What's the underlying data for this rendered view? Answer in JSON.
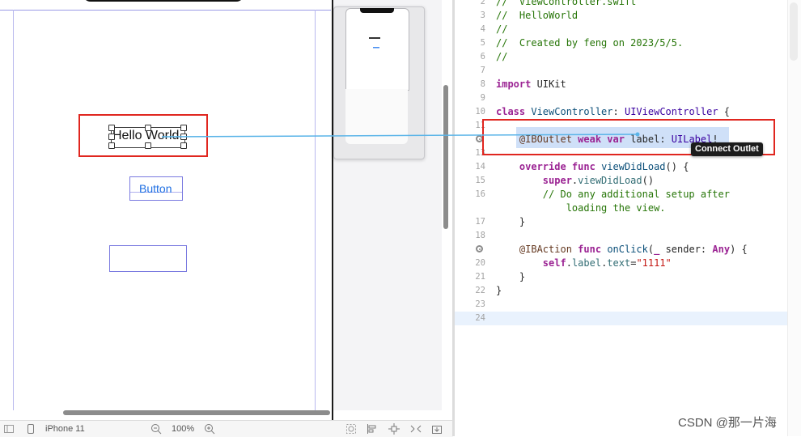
{
  "canvas": {
    "label_text": "Hello World",
    "button_label": "Button"
  },
  "bottom_toolbar": {
    "device_name": "iPhone 11",
    "zoom_level": "100%"
  },
  "editor": {
    "lines": [
      {
        "num": "2",
        "segments": [
          {
            "cls": "cm",
            "text": "//  ViewController.swift"
          }
        ]
      },
      {
        "num": "3",
        "segments": [
          {
            "cls": "cm",
            "text": "//  HelloWorld"
          }
        ]
      },
      {
        "num": "4",
        "segments": [
          {
            "cls": "cm",
            "text": "//"
          }
        ]
      },
      {
        "num": "5",
        "segments": [
          {
            "cls": "cm",
            "text": "//  Created by feng on 2023/5/5."
          }
        ]
      },
      {
        "num": "6",
        "segments": [
          {
            "cls": "cm",
            "text": "//"
          }
        ]
      },
      {
        "num": "7",
        "segments": []
      },
      {
        "num": "8",
        "segments": [
          {
            "cls": "k",
            "text": "import"
          },
          {
            "cls": "",
            "text": " UIKit"
          }
        ]
      },
      {
        "num": "9",
        "segments": []
      },
      {
        "num": "10",
        "segments": [
          {
            "cls": "k",
            "text": "class"
          },
          {
            "cls": "",
            "text": " "
          },
          {
            "cls": "t2",
            "text": "ViewController"
          },
          {
            "cls": "",
            "text": ": "
          },
          {
            "cls": "t",
            "text": "UIViewController"
          },
          {
            "cls": "",
            "text": " {"
          }
        ]
      },
      {
        "num": "11",
        "segments": []
      },
      {
        "num": "12",
        "segments": [
          {
            "cls": "",
            "text": "    "
          },
          {
            "cls": "at",
            "text": "@IBOutlet"
          },
          {
            "cls": "",
            "text": " "
          },
          {
            "cls": "k",
            "text": "weak var"
          },
          {
            "cls": "",
            "text": " label: "
          },
          {
            "cls": "t",
            "text": "UILabel"
          },
          {
            "cls": "",
            "text": "!"
          }
        ]
      },
      {
        "num": "13",
        "segments": []
      },
      {
        "num": "14",
        "segments": [
          {
            "cls": "",
            "text": "    "
          },
          {
            "cls": "k",
            "text": "override func"
          },
          {
            "cls": "",
            "text": " "
          },
          {
            "cls": "t2",
            "text": "viewDidLoad"
          },
          {
            "cls": "",
            "text": "() {"
          }
        ]
      },
      {
        "num": "15",
        "segments": [
          {
            "cls": "",
            "text": "        "
          },
          {
            "cls": "k",
            "text": "super"
          },
          {
            "cls": "",
            "text": "."
          },
          {
            "cls": "p",
            "text": "viewDidLoad"
          },
          {
            "cls": "",
            "text": "()"
          }
        ]
      },
      {
        "num": "16",
        "segments": [
          {
            "cls": "",
            "text": "        "
          },
          {
            "cls": "cm",
            "text": "// Do any additional setup after"
          }
        ]
      },
      {
        "num": "",
        "segments": [
          {
            "cls": "",
            "text": "            "
          },
          {
            "cls": "cm",
            "text": "loading the view."
          }
        ]
      },
      {
        "num": "17",
        "segments": [
          {
            "cls": "",
            "text": "    }"
          }
        ]
      },
      {
        "num": "18",
        "segments": []
      },
      {
        "num": "19",
        "segments": [
          {
            "cls": "",
            "text": "    "
          },
          {
            "cls": "at",
            "text": "@IBAction"
          },
          {
            "cls": "",
            "text": " "
          },
          {
            "cls": "k",
            "text": "func"
          },
          {
            "cls": "",
            "text": " "
          },
          {
            "cls": "t2",
            "text": "onClick"
          },
          {
            "cls": "",
            "text": "("
          },
          {
            "cls": "k",
            "text": "_"
          },
          {
            "cls": "",
            "text": " sender: "
          },
          {
            "cls": "k",
            "text": "Any"
          },
          {
            "cls": "",
            "text": ") {"
          }
        ]
      },
      {
        "num": "20",
        "segments": [
          {
            "cls": "",
            "text": "        "
          },
          {
            "cls": "k",
            "text": "self"
          },
          {
            "cls": "",
            "text": "."
          },
          {
            "cls": "p",
            "text": "label"
          },
          {
            "cls": "",
            "text": "."
          },
          {
            "cls": "p",
            "text": "text"
          },
          {
            "cls": "",
            "text": "="
          },
          {
            "cls": "s",
            "text": "\"1111\""
          }
        ]
      },
      {
        "num": "21",
        "segments": [
          {
            "cls": "",
            "text": "    }"
          }
        ]
      },
      {
        "num": "22",
        "segments": [
          {
            "cls": "",
            "text": "}"
          }
        ]
      },
      {
        "num": "23",
        "segments": []
      },
      {
        "num": "24",
        "segments": []
      }
    ]
  },
  "connect_tooltip": "Connect Outlet",
  "watermark": "CSDN @那一片海",
  "colors": {
    "annotation_red": "#e0261f",
    "connection_line": "#5ab4e8",
    "constraint_guide": "#9a9ae6",
    "button_tint": "#1f6fe3"
  }
}
